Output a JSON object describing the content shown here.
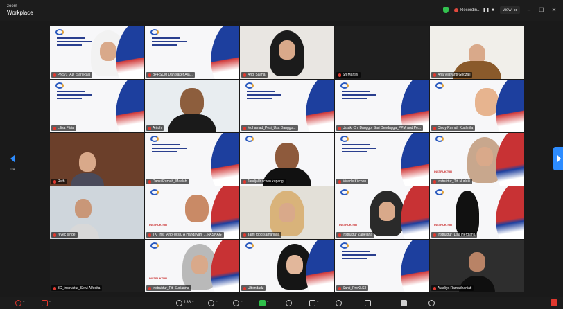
{
  "window": {
    "app": "zoom",
    "title": "Workplace"
  },
  "topbar": {
    "recording_label": "Recordin...",
    "view_label": "View",
    "colors": {
      "shield": "#33c24f",
      "record": "#e0493e"
    }
  },
  "pager": {
    "page_current": "1/4"
  },
  "participants": [
    {
      "name": "PNS/1_AD_Sari Rals",
      "muted": true
    },
    {
      "name": "BPPSDM Dan saker Ala...",
      "muted": true
    },
    {
      "name": "Andi Salma",
      "muted": true
    },
    {
      "name": "Sri Martini",
      "muted": true
    },
    {
      "name": "Ana Vilayanti Ghozali",
      "muted": true
    },
    {
      "name": "Lilisa Fitria",
      "muted": true
    },
    {
      "name": "Aritoh",
      "muted": true
    },
    {
      "name": "Mohamad_Pesi_Usa Danggo...",
      "muted": true
    },
    {
      "name": "Ursaki Chi Danggo, Sari Dendagga_PPM and Pe...",
      "muted": true
    },
    {
      "name": "Cindy Rumah Kuahnila",
      "muted": true
    },
    {
      "name": "Ruth",
      "muted": true
    },
    {
      "name": "Dansi Rumah_Maalah",
      "muted": true
    },
    {
      "name": "Jandjal Kitchen kupang",
      "muted": true
    },
    {
      "name": "Miracle Kitchen",
      "muted": true
    },
    {
      "name": "Instruktur_Titi Nurlaili",
      "muted": true
    },
    {
      "name": "revec singe",
      "muted": true
    },
    {
      "name": "TK_Inst_Arjo-Wisiu A Handayani ... PASNAG",
      "muted": true
    },
    {
      "name": "Tami food samarinda",
      "muted": true
    },
    {
      "name": "Instruktur Zapelaria",
      "muted": true
    },
    {
      "name": "Instruktur_Lisa Herdianti",
      "muted": true
    },
    {
      "name": "3C_Instruktur_Selvi Alfedita",
      "muted": true
    },
    {
      "name": "Instruktur_Fiti Susianna",
      "muted": true
    },
    {
      "name": "Ultisndadz",
      "muted": true
    },
    {
      "name": "Santi_ProKLS3",
      "muted": true
    },
    {
      "name": "Awaliya Ramadhaniati",
      "muted": true
    }
  ],
  "instructor_tag": "INSTRUKTUR",
  "toolbar": {
    "participants_count": "136"
  }
}
